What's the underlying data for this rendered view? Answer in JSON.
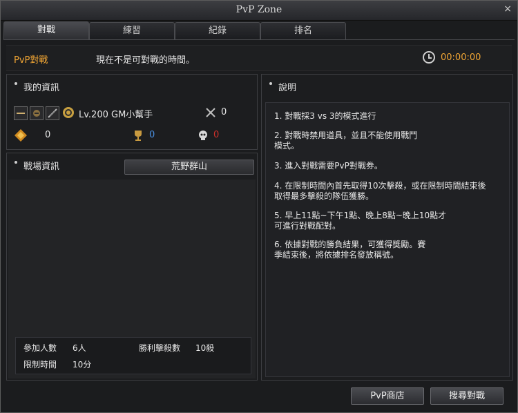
{
  "window": {
    "title": "PvP Zone",
    "close": "×"
  },
  "tabs": [
    {
      "label": "對戰",
      "active": true
    },
    {
      "label": "練習",
      "active": false
    },
    {
      "label": "紀錄",
      "active": false
    },
    {
      "label": "排名",
      "active": false
    }
  ],
  "status": {
    "label": "PvP對戰",
    "message": "現在不是可對戰的時間。",
    "timer": "00:00:00"
  },
  "my_info": {
    "title": "我的資訊",
    "player": "Lv.200 GM小幫手",
    "kills": "0",
    "points": "0",
    "wins": "0",
    "deaths": "0"
  },
  "battlefield": {
    "title": "戰場資訊",
    "map_button": "荒野群山",
    "participants_label": "參加人數",
    "participants_value": "6人",
    "win_kills_label": "勝利擊殺數",
    "win_kills_value": "10殺",
    "time_limit_label": "限制時間",
    "time_limit_value": "10分"
  },
  "description": {
    "title": "說明",
    "items": [
      [
        "1. 對戰採3 vs 3的模式進行"
      ],
      [
        "2. 對戰時禁用道具，並且不能使用戰鬥",
        "模式。"
      ],
      [
        "3. 進入對戰需要PvP對戰券。"
      ],
      [
        "4. 在限制時間內首先取得10次擊殺，或在限制時間結束後",
        "取得最多擊殺的隊伍獲勝。"
      ],
      [
        "5. 早上11點~下午1點、晚上8點~晚上10點才",
        "可進行對戰配對。"
      ],
      [
        "6. 依據對戰的勝負結果，可獲得獎勵。賽",
        "季結束後，將依據排名發放稱號。"
      ]
    ]
  },
  "buttons": {
    "shop": "PvP商店",
    "search": "搜尋對戰"
  },
  "colors": {
    "accent": "#f0a534",
    "wins": "#4a90e2",
    "deaths": "#d0302a"
  },
  "icons": [
    "sword-icon",
    "helmet-icon",
    "feather-icon",
    "smiley-icon",
    "crossed-swords-icon",
    "diamond-icon",
    "trophy-icon",
    "skull-icon",
    "clock-icon",
    "close-icon"
  ]
}
